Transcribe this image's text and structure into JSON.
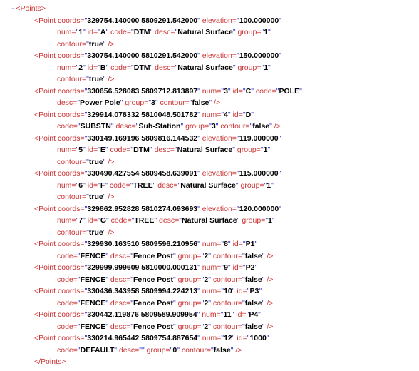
{
  "root": {
    "open": "<Points>",
    "close": "</Points>",
    "minus": "-"
  },
  "p": [
    {
      "a": [
        [
          "coords",
          "329754.140000 5809291.542000"
        ],
        [
          "elevation",
          "100.000000"
        ],
        [
          "num",
          "1"
        ],
        [
          "id",
          "A"
        ],
        [
          "code",
          "DTM"
        ],
        [
          "desc",
          "Natural Surface"
        ],
        [
          "group",
          "1"
        ],
        [
          "contour",
          "true"
        ]
      ],
      "br": [
        2,
        7
      ]
    },
    {
      "a": [
        [
          "coords",
          "330754.140000 5810291.542000"
        ],
        [
          "elevation",
          "150.000000"
        ],
        [
          "num",
          "2"
        ],
        [
          "id",
          "B"
        ],
        [
          "code",
          "DTM"
        ],
        [
          "desc",
          "Natural Surface"
        ],
        [
          "group",
          "1"
        ],
        [
          "contour",
          "true"
        ]
      ],
      "br": [
        2,
        7
      ]
    },
    {
      "a": [
        [
          "coords",
          "330656.528083 5809712.813897"
        ],
        [
          "num",
          "3"
        ],
        [
          "id",
          "C"
        ],
        [
          "code",
          "POLE"
        ],
        [
          "desc",
          "Power Pole"
        ],
        [
          "group",
          "3"
        ],
        [
          "contour",
          "false"
        ]
      ],
      "br": [
        4
      ]
    },
    {
      "a": [
        [
          "coords",
          "329914.078332 5810048.501782"
        ],
        [
          "num",
          "4"
        ],
        [
          "id",
          "D"
        ],
        [
          "code",
          "SUBSTN"
        ],
        [
          "desc",
          "Sub-Station"
        ],
        [
          "group",
          "3"
        ],
        [
          "contour",
          "false"
        ]
      ],
      "br": [
        3
      ]
    },
    {
      "a": [
        [
          "coords",
          "330149.169196 5809816.144532"
        ],
        [
          "elevation",
          "119.000000"
        ],
        [
          "num",
          "5"
        ],
        [
          "id",
          "E"
        ],
        [
          "code",
          "DTM"
        ],
        [
          "desc",
          "Natural Surface"
        ],
        [
          "group",
          "1"
        ],
        [
          "contour",
          "true"
        ]
      ],
      "br": [
        2,
        7
      ]
    },
    {
      "a": [
        [
          "coords",
          "330490.427554 5809458.639091"
        ],
        [
          "elevation",
          "115.000000"
        ],
        [
          "num",
          "6"
        ],
        [
          "id",
          "F"
        ],
        [
          "code",
          "TREE"
        ],
        [
          "desc",
          "Natural Surface"
        ],
        [
          "group",
          "1"
        ],
        [
          "contour",
          "true"
        ]
      ],
      "br": [
        2,
        7
      ]
    },
    {
      "a": [
        [
          "coords",
          "329862.952828 5810274.093693"
        ],
        [
          "elevation",
          "120.000000"
        ],
        [
          "num",
          "7"
        ],
        [
          "id",
          "G"
        ],
        [
          "code",
          "TREE"
        ],
        [
          "desc",
          "Natural Surface"
        ],
        [
          "group",
          "1"
        ],
        [
          "contour",
          "true"
        ]
      ],
      "br": [
        2,
        7
      ]
    },
    {
      "a": [
        [
          "coords",
          "329930.163510 5809596.210956"
        ],
        [
          "num",
          "8"
        ],
        [
          "id",
          "P1"
        ],
        [
          "code",
          "FENCE"
        ],
        [
          "desc",
          "Fence Post"
        ],
        [
          "group",
          "2"
        ],
        [
          "contour",
          "false"
        ]
      ],
      "br": [
        3
      ]
    },
    {
      "a": [
        [
          "coords",
          "329999.999609 5810000.000131"
        ],
        [
          "num",
          "9"
        ],
        [
          "id",
          "P2"
        ],
        [
          "code",
          "FENCE"
        ],
        [
          "desc",
          "Fence Post"
        ],
        [
          "group",
          "2"
        ],
        [
          "contour",
          "false"
        ]
      ],
      "br": [
        3
      ]
    },
    {
      "a": [
        [
          "coords",
          "330436.343958 5809994.224213"
        ],
        [
          "num",
          "10"
        ],
        [
          "id",
          "P3"
        ],
        [
          "code",
          "FENCE"
        ],
        [
          "desc",
          "Fence Post"
        ],
        [
          "group",
          "2"
        ],
        [
          "contour",
          "false"
        ]
      ],
      "br": [
        3
      ]
    },
    {
      "a": [
        [
          "coords",
          "330442.119876 5809589.909954"
        ],
        [
          "num",
          "11"
        ],
        [
          "id",
          "P4"
        ],
        [
          "code",
          "FENCE"
        ],
        [
          "desc",
          "Fence Post"
        ],
        [
          "group",
          "2"
        ],
        [
          "contour",
          "false"
        ]
      ],
      "br": [
        3
      ]
    },
    {
      "a": [
        [
          "coords",
          "330214.965442 5809754.887654"
        ],
        [
          "num",
          "12"
        ],
        [
          "id",
          "1000"
        ],
        [
          "code",
          "DEFAULT"
        ],
        [
          "desc",
          ""
        ],
        [
          "group",
          "0"
        ],
        [
          "contour",
          "false"
        ]
      ],
      "br": [
        3
      ]
    }
  ]
}
